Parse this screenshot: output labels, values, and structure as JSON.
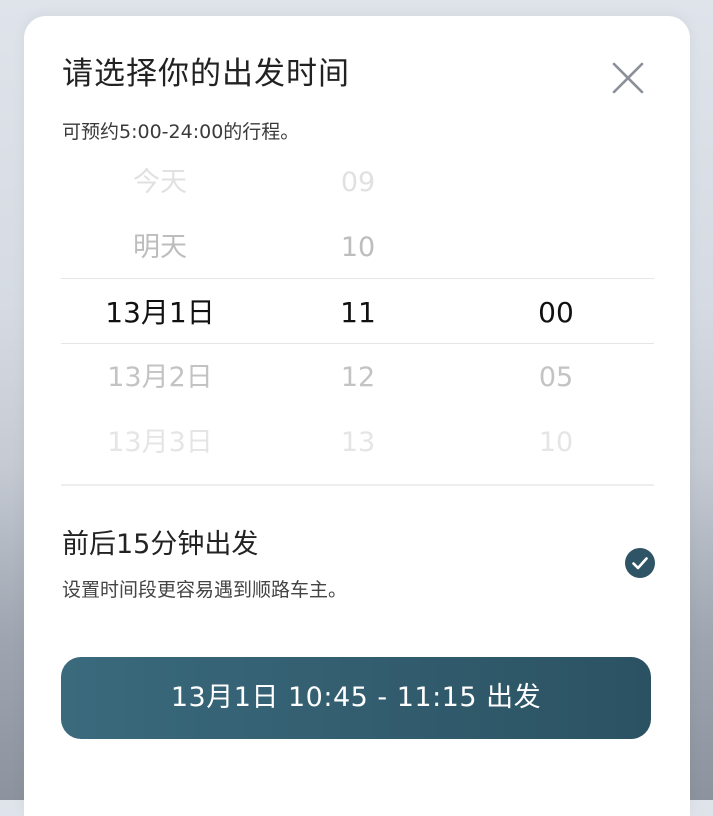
{
  "dialog": {
    "title": "请选择你的出发时间",
    "subtitle": "可预约5:00-24:00的行程。"
  },
  "picker": {
    "days": [
      "今天",
      "明天",
      "13月1日",
      "13月2日",
      "13月3日"
    ],
    "hours": [
      "09",
      "10",
      "11",
      "12",
      "13"
    ],
    "minutes": [
      "",
      "",
      "00",
      "05",
      "10"
    ],
    "selected": {
      "day": "13月1日",
      "hour": "11",
      "minute": "00"
    }
  },
  "flexible": {
    "title": "前后15分钟出发",
    "description": "设置时间段更容易遇到顺路车主。",
    "checked": true
  },
  "confirm_button": {
    "label": "13月1日 10:45 - 11:15 出发"
  },
  "colors": {
    "accent": "#2f5466",
    "button_start": "#3a6a7d",
    "button_end": "#2b5262"
  },
  "icons": {
    "close": "close-icon",
    "check": "check-circle-icon"
  }
}
